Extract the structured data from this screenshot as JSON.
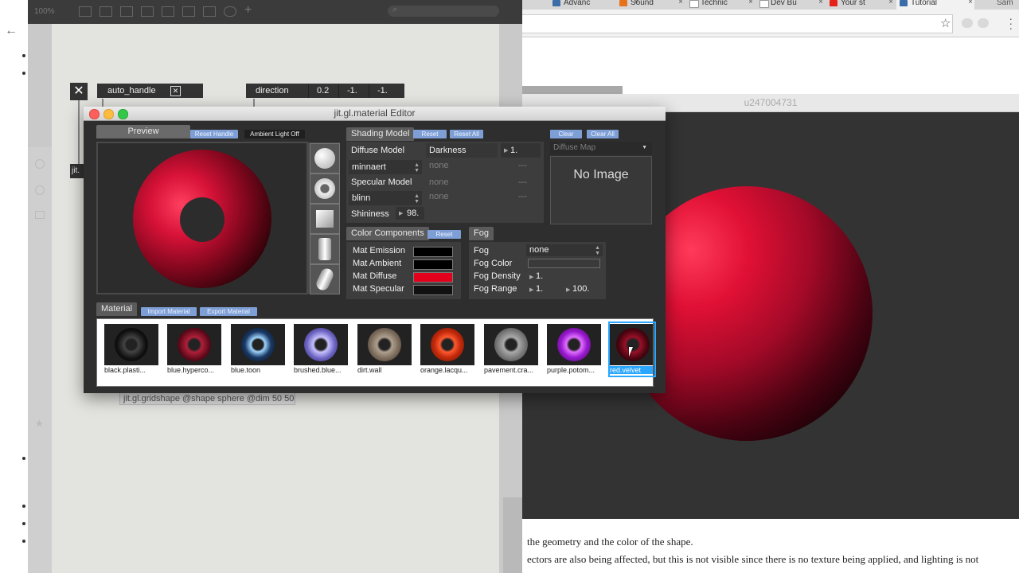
{
  "browser": {
    "tabs": [
      {
        "label": "Advanc",
        "color": "#3b6ea8"
      },
      {
        "label": "Sound",
        "color": "#e8711c"
      },
      {
        "label": "Technic",
        "color": "#cfcfcf"
      },
      {
        "label": "Dev Bu",
        "color": "#cfcfcf"
      },
      {
        "label": "Your st",
        "color": "#e62117"
      },
      {
        "label": "Tutorial",
        "color": "#3b6ea8"
      }
    ],
    "profile_label": "Sam"
  },
  "page_text": {
    "line1": "the geometry and the color of the shape.",
    "line2": "ectors are also being affected, but this is not visible since there is no texture being applied, and lighting is not"
  },
  "max_toolbar": {
    "zoom": "100%"
  },
  "patch": {
    "auto_handle_label": "auto_handle",
    "direction_label": "direction",
    "direction_values": [
      "0.2",
      "-1.",
      "-1."
    ],
    "jit_label": "jit.",
    "gridshape_label": "jit.gl.gridshape @shape sphere @dim 50 50"
  },
  "render_window": {
    "title": "u247004731"
  },
  "editor": {
    "title": "jit.gl.material Editor",
    "preview_tab": "Preview",
    "reset_handle": "Reset Handle",
    "ambient_light_off": "Ambient Light Off",
    "shading": {
      "tab": "Shading Model",
      "reset": "Reset",
      "reset_all": "Reset All",
      "diffuse_model_label": "Diffuse Model",
      "diffuse_model_value": "minnaert",
      "specular_model_label": "Specular Model",
      "specular_model_value": "blinn",
      "shininess_label": "Shininess",
      "shininess_value": "98.",
      "param_rows": [
        {
          "name": "Darkness",
          "value": "1."
        },
        {
          "name": "none",
          "value": "---"
        },
        {
          "name": "none",
          "value": "---"
        },
        {
          "name": "none",
          "value": "---"
        }
      ]
    },
    "texture": {
      "clear": "Clear",
      "clear_all": "Clear All",
      "map_select": "Diffuse Map",
      "no_image": "No Image"
    },
    "color_components": {
      "tab": "Color Components",
      "reset": "Reset",
      "rows": [
        {
          "label": "Mat Emission",
          "color": "#000000"
        },
        {
          "label": "Mat Ambient",
          "color": "#000000"
        },
        {
          "label": "Mat Diffuse",
          "color": "#e3001c"
        },
        {
          "label": "Mat Specular",
          "color": "#111111"
        }
      ]
    },
    "fog": {
      "tab": "Fog",
      "fog_label": "Fog",
      "fog_value": "none",
      "fog_color_label": "Fog Color",
      "fog_density_label": "Fog Density",
      "fog_density_value": "1.",
      "fog_range_label": "Fog Range",
      "fog_range_start": "1.",
      "fog_range_end": "100."
    },
    "material": {
      "tab": "Material",
      "import": "Import Material",
      "export": "Export Material",
      "presets": [
        {
          "label": "black.plasti...",
          "color": "#1a1a1a"
        },
        {
          "label": "blue.hyperco...",
          "color": "#6b1020"
        },
        {
          "label": "blue.toon",
          "color": "#1a3a66"
        },
        {
          "label": "brushed.blue...",
          "color": "#7a72cc"
        },
        {
          "label": "dirt.wall",
          "color": "#8a7a6a"
        },
        {
          "label": "orange.lacqu...",
          "color": "#c42a0c"
        },
        {
          "label": "pavement.cra...",
          "color": "#7b7b7b"
        },
        {
          "label": "purple.potom...",
          "color": "#9a1ad0"
        },
        {
          "label": "red.velvet",
          "color": "#6e0a1a"
        }
      ],
      "selected": "red.velvet"
    }
  },
  "colors": {
    "accent": "#7e9fd6",
    "selection": "#2aa6ff",
    "sphere_red": "#d6123a"
  }
}
